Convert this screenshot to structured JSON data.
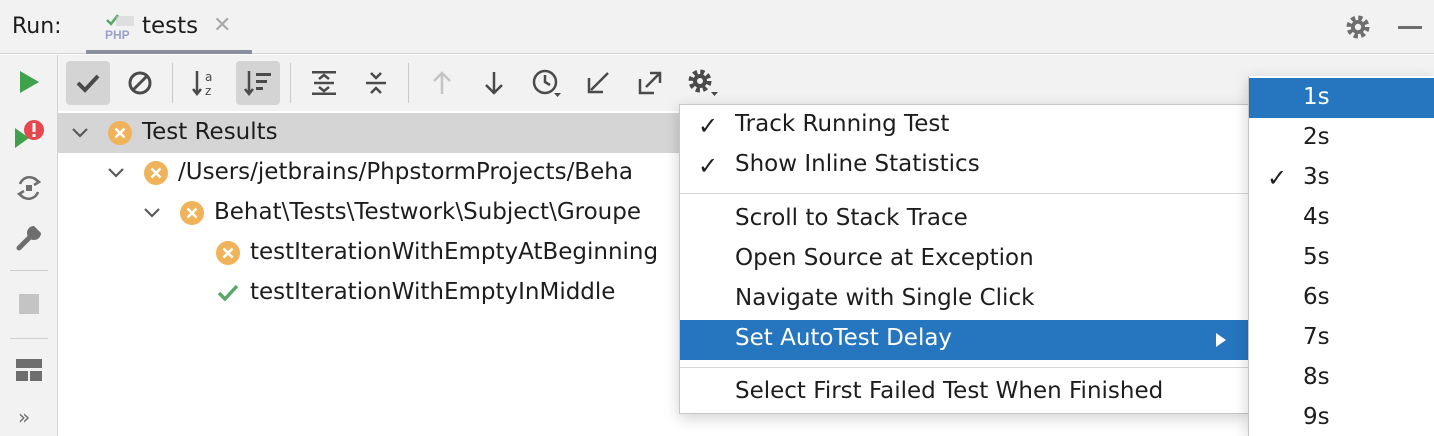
{
  "header": {
    "run_label": "Run:",
    "tab_label": "tests",
    "tab_icon": "php-test-icon",
    "tab_close": "✕"
  },
  "left_toolbar": {
    "icons": [
      "run-icon",
      "rerun-failed-icon",
      "toggle-auto-test-icon",
      "wrench-icon",
      "stop-icon",
      "layout-icon"
    ],
    "more": "»"
  },
  "toolbar": {
    "icons": [
      "show-passed-icon",
      "show-ignored-icon",
      "sort-alphabetically-icon",
      "sort-by-duration-icon",
      "expand-all-icon",
      "collapse-all-icon",
      "previous-failed-icon",
      "next-failed-icon",
      "test-history-icon",
      "import-tests-icon",
      "export-tests-icon",
      "settings-icon"
    ]
  },
  "tree": {
    "rows": [
      {
        "text": "Test Results",
        "status": "failed"
      },
      {
        "text": "/Users/jetbrains/PhpstormProjects/Beha",
        "status": "failed"
      },
      {
        "text": "Behat\\Tests\\Testwork\\Subject\\Groupe",
        "status": "failed"
      },
      {
        "text": "testIterationWithEmptyAtBeginning",
        "status": "failed"
      },
      {
        "text": "testIterationWithEmptyInMiddle",
        "status": "passed"
      }
    ]
  },
  "menu": {
    "items": [
      {
        "label": "Track Running Test",
        "checked": "✓"
      },
      {
        "label": "Show Inline Statistics",
        "checked": "✓"
      },
      {
        "label": "Scroll to Stack Trace",
        "checked": ""
      },
      {
        "label": "Open Source at Exception",
        "checked": ""
      },
      {
        "label": "Navigate with Single Click",
        "checked": ""
      },
      {
        "label": "Set AutoTest Delay",
        "checked": ""
      },
      {
        "label": "Select First Failed Test When Finished",
        "checked": ""
      }
    ]
  },
  "submenu": {
    "items": [
      {
        "label": "1s",
        "checked": ""
      },
      {
        "label": "2s",
        "checked": ""
      },
      {
        "label": "3s",
        "checked": "✓"
      },
      {
        "label": "4s",
        "checked": ""
      },
      {
        "label": "5s",
        "checked": ""
      },
      {
        "label": "6s",
        "checked": ""
      },
      {
        "label": "7s",
        "checked": ""
      },
      {
        "label": "8s",
        "checked": ""
      },
      {
        "label": "9s",
        "checked": ""
      }
    ]
  },
  "colors": {
    "selection": "#2675bf",
    "failed": "#f0b35a",
    "passed": "#59a869",
    "run": "#3fa14b",
    "error": "#e5484d"
  }
}
